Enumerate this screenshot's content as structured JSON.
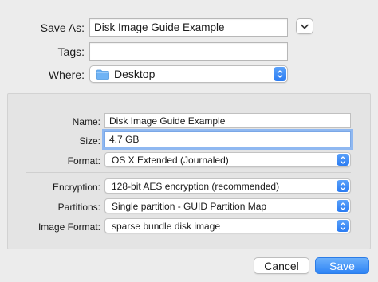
{
  "dialog": {
    "save_as": {
      "label": "Save As:",
      "value": "Disk Image Guide Example"
    },
    "tags": {
      "label": "Tags:",
      "value": ""
    },
    "where": {
      "label": "Where:",
      "value": "Desktop",
      "icon": "folder-icon"
    }
  },
  "options": {
    "name": {
      "label": "Name:",
      "value": "Disk Image Guide Example"
    },
    "size": {
      "label": "Size:",
      "value": "4.7 GB"
    },
    "format": {
      "label": "Format:",
      "value": "OS X Extended (Journaled)"
    },
    "encryption": {
      "label": "Encryption:",
      "value": "128-bit AES encryption (recommended)"
    },
    "partitions": {
      "label": "Partitions:",
      "value": "Single partition - GUID Partition Map"
    },
    "image_format": {
      "label": "Image Format:",
      "value": "sparse bundle disk image"
    }
  },
  "buttons": {
    "cancel": "Cancel",
    "save": "Save"
  },
  "colors": {
    "accent": "#2e84f5",
    "folder": "#6fb3f5",
    "panel": "#e4e4e4",
    "window": "#ececec"
  }
}
